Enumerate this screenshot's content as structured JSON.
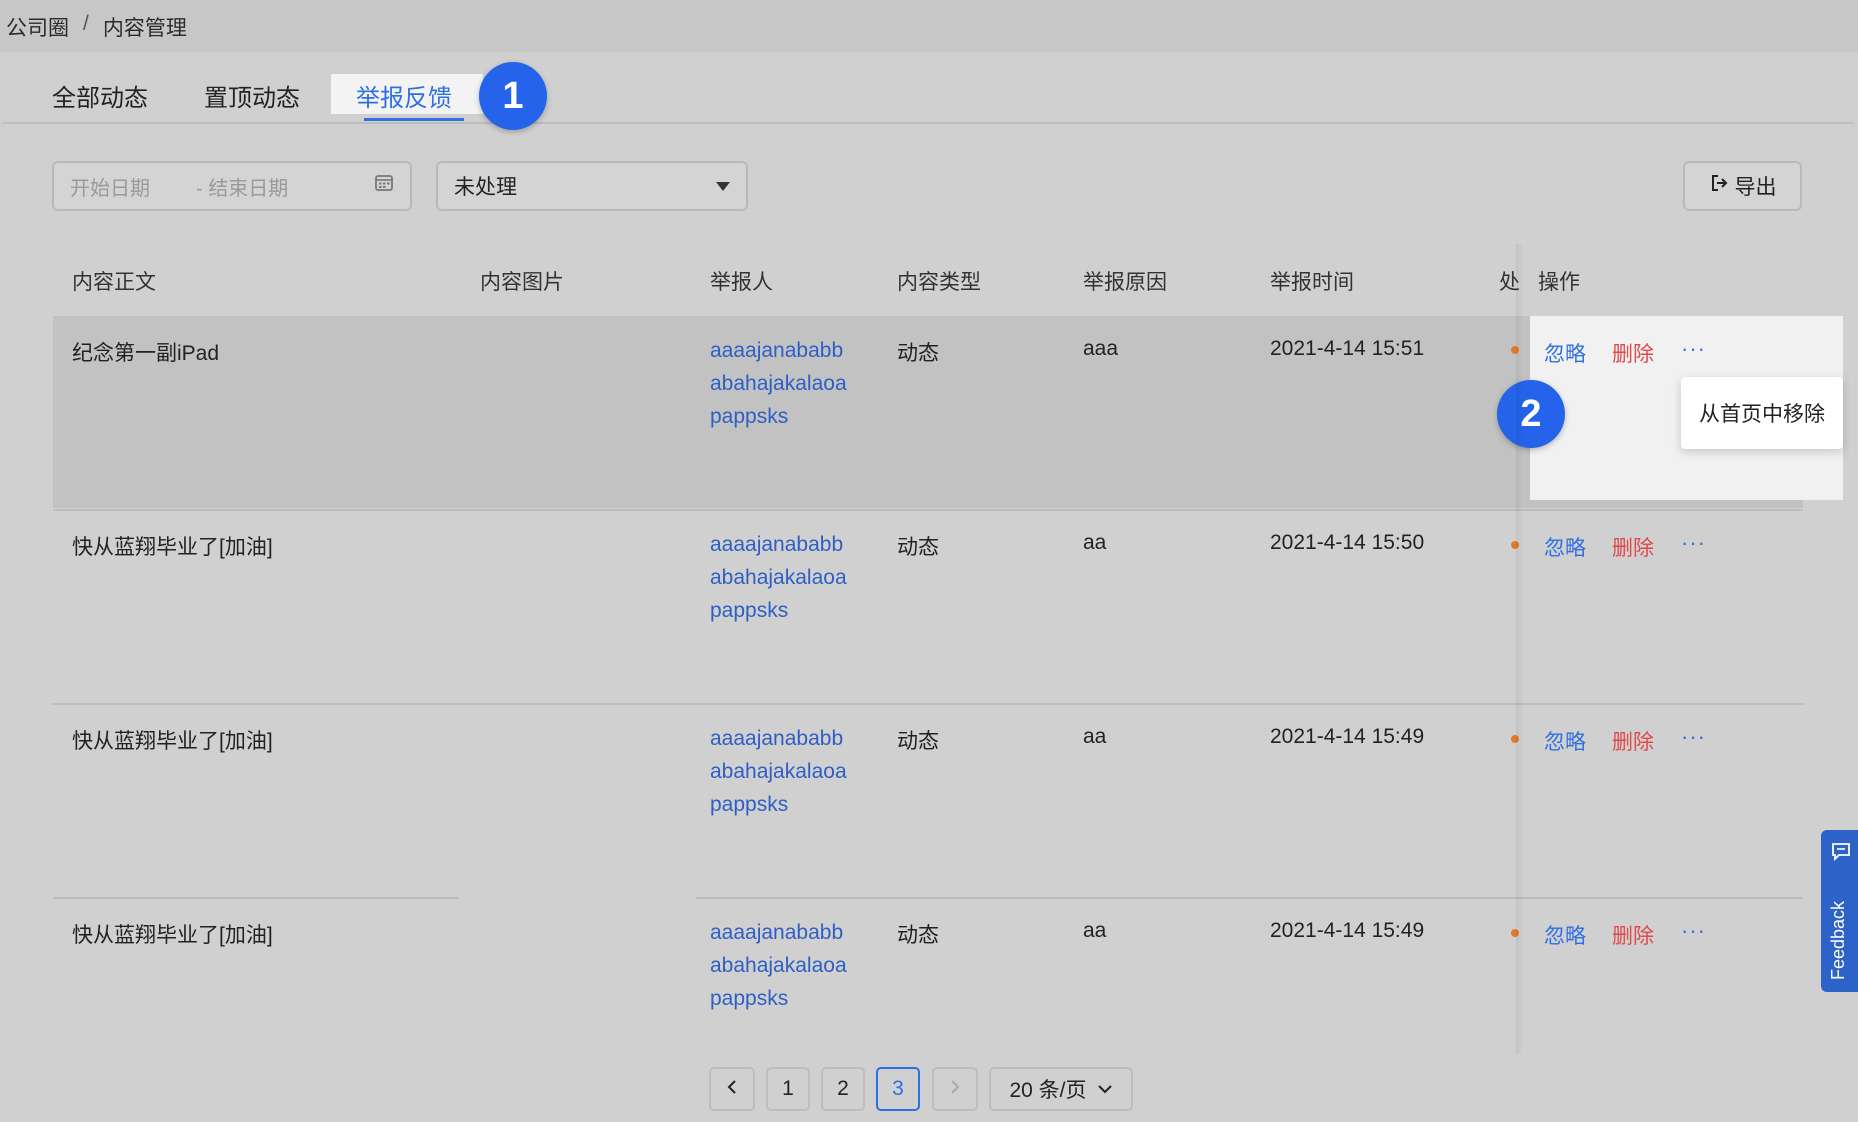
{
  "breadcrumb": {
    "root": "公司圈",
    "sep": "/",
    "current": "内容管理"
  },
  "tabs": [
    "全部动态",
    "置顶动态",
    "举报反馈"
  ],
  "bubbles": {
    "one": "1",
    "two": "2"
  },
  "filters": {
    "start_placeholder": "开始日期",
    "end_placeholder": "- 结束日期",
    "status": "未处理",
    "export": "导出"
  },
  "table": {
    "headers": [
      "内容正文",
      "内容图片",
      "举报人",
      "内容类型",
      "举报原因",
      "举报时间",
      "处",
      "操作"
    ],
    "rows": [
      {
        "content": "纪念第一副iPad",
        "reporter": [
          "aaaajanababb",
          "abahajakalaoa",
          "pappsks"
        ],
        "type": "动态",
        "reason": "aaa",
        "time": "2021-4-14 15:51"
      },
      {
        "content": "快从蓝翔毕业了[加油]",
        "reporter": [
          "aaaajanababb",
          "abahajakalaoa",
          "pappsks"
        ],
        "type": "动态",
        "reason": "aa",
        "time": "2021-4-14 15:50"
      },
      {
        "content": "快从蓝翔毕业了[加油]",
        "reporter": [
          "aaaajanababb",
          "abahajakalaoa",
          "pappsks"
        ],
        "type": "动态",
        "reason": "aa",
        "time": "2021-4-14 15:49"
      },
      {
        "content": "快从蓝翔毕业了[加油]",
        "reporter": [
          "aaaajanababb",
          "abahajakalaoa",
          "pappsks"
        ],
        "type": "动态",
        "reason": "aa",
        "time": "2021-4-14 15:49"
      }
    ],
    "actions": {
      "ignore": "忽略",
      "delete": "删除",
      "more": "···"
    },
    "more_menu": "从首页中移除"
  },
  "pagination": {
    "prev": "<",
    "pages": [
      "1",
      "2",
      "3"
    ],
    "current": "3",
    "next": ">",
    "page_size": "20 条/页"
  },
  "feedback": "Feedback",
  "colors": {
    "accent": "#2f6fe4",
    "danger": "#e04a4a",
    "status_dot": "#e07b2a",
    "bubble": "#2563eb"
  }
}
